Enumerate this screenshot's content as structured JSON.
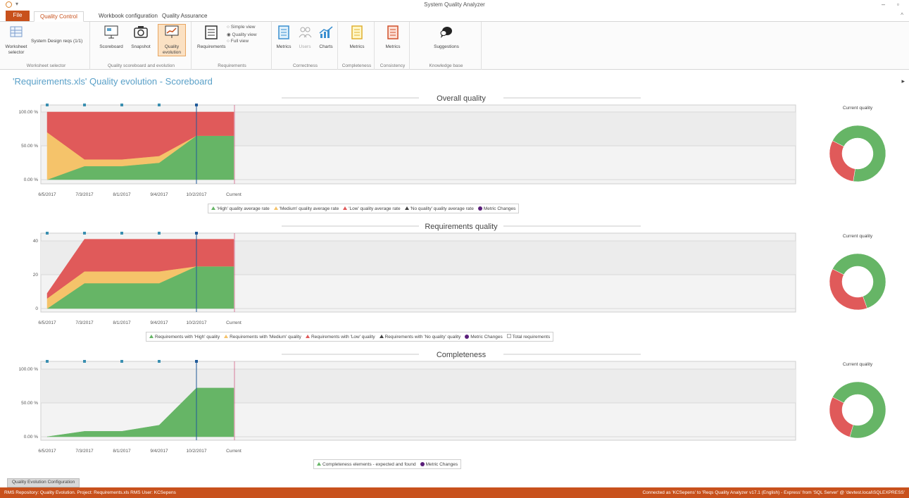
{
  "app": {
    "title": "System Quality Analyzer"
  },
  "tabs": [
    "File",
    "Quality Control",
    "Workbook configuration",
    "Quality Assurance"
  ],
  "ribbon": {
    "groups": [
      {
        "label": "Worksheet selector",
        "buttons": [
          "Worksheet selector",
          "System Design reqs (1/1)"
        ]
      },
      {
        "label": "Quality scoreboard and evolution",
        "buttons": [
          "Scoreboard",
          "Snapshot",
          "Quality evolution"
        ]
      },
      {
        "label": "Requirements",
        "buttons": [
          "Requirements"
        ],
        "options": [
          "Simple view",
          "Quality view",
          "Full view"
        ]
      },
      {
        "label": "Correctness",
        "buttons": [
          "Metrics",
          "Users",
          "Charts"
        ]
      },
      {
        "label": "Completeness",
        "buttons": [
          "Metrics"
        ]
      },
      {
        "label": "Consistency",
        "buttons": [
          "Metrics"
        ]
      },
      {
        "label": "Knowledge base",
        "buttons": [
          "Suggestions"
        ]
      }
    ]
  },
  "page_title": "'Requirements.xls' Quality evolution - Scoreboard",
  "donut_label": "Current quality",
  "colors": {
    "high": "#66b566",
    "medium": "#f5c36a",
    "low": "#e05a5a",
    "marker": "#1f5a99",
    "accent": "#c8511c"
  },
  "chart_data": [
    {
      "type": "area",
      "title": "Overall quality",
      "categories": [
        "6/5/2017",
        "7/3/2017",
        "8/1/2017",
        "9/4/2017",
        "10/2/2017",
        "Current"
      ],
      "y_ticks": [
        "100.00 %",
        "50.00 %",
        "0.00 %"
      ],
      "ylim": [
        0,
        100
      ],
      "stacked": true,
      "series": [
        {
          "name": "'High' quality average rate",
          "values": [
            0,
            20,
            20,
            25,
            65,
            65
          ]
        },
        {
          "name": "'Medium' quality average rate",
          "values": [
            70,
            10,
            10,
            10,
            0,
            0
          ]
        },
        {
          "name": "'Low' quality average rate",
          "values": [
            30,
            70,
            70,
            65,
            35,
            35
          ]
        },
        {
          "name": "'No quality' quality average rate",
          "values": [
            0,
            0,
            0,
            0,
            0,
            0
          ]
        }
      ],
      "legend": [
        "'High' quality average rate",
        "'Medium' quality average rate",
        "'Low' quality average rate",
        "'No quality' quality average rate",
        "Metric Changes"
      ],
      "donut": {
        "high": 70,
        "low": 30
      }
    },
    {
      "type": "area",
      "title": "Requirements quality",
      "categories": [
        "6/5/2017",
        "7/3/2017",
        "8/1/2017",
        "9/4/2017",
        "10/2/2017",
        "Current"
      ],
      "y_ticks": [
        "40",
        "20",
        "0"
      ],
      "ylim": [
        0,
        45
      ],
      "stacked": true,
      "series": [
        {
          "name": "Requirements with 'High' quality",
          "values": [
            0,
            15,
            15,
            15,
            25,
            25
          ]
        },
        {
          "name": "Requirements with 'Medium' quality",
          "values": [
            6,
            7,
            7,
            7,
            0,
            0
          ]
        },
        {
          "name": "Requirements with 'Low' quality",
          "values": [
            3,
            19,
            19,
            19,
            16,
            16
          ]
        },
        {
          "name": "Requirements with 'No quality' quality",
          "values": [
            0,
            0,
            0,
            0,
            0,
            0
          ]
        }
      ],
      "legend": [
        "Requirements with 'High' quality",
        "Requirements with 'Medium' quality",
        "Requirements with 'Low' quality",
        "Requirements with 'No quality' quality",
        "Metric Changes",
        "Total requirements"
      ],
      "donut": {
        "high": 62,
        "low": 38
      }
    },
    {
      "type": "area",
      "title": "Completeness",
      "categories": [
        "6/5/2017",
        "7/3/2017",
        "8/1/2017",
        "9/4/2017",
        "10/2/2017",
        "Current"
      ],
      "y_ticks": [
        "100.00 %",
        "50.00 %",
        "0.00 %"
      ],
      "ylim": [
        0,
        100
      ],
      "stacked": true,
      "series": [
        {
          "name": "Completeness elements - expected and found",
          "values": [
            0,
            8,
            8,
            17,
            72,
            72
          ]
        }
      ],
      "legend": [
        "Completeness elements - expected and found",
        "Metric Changes"
      ],
      "donut": {
        "high": 72,
        "low": 28
      }
    }
  ],
  "bottom_tab": "Quality Evolution Configuration",
  "status": {
    "left": "RMS Repository: Quality Evolution. Project: Requirements.xls     RMS User: KCSepens",
    "right": "Connected as 'KCSepens' to 'Reqs Quality Analyzer v17.1 (English) - Express' from 'SQL Server' @ 'devtest.local\\SQLEXPRESS'"
  }
}
